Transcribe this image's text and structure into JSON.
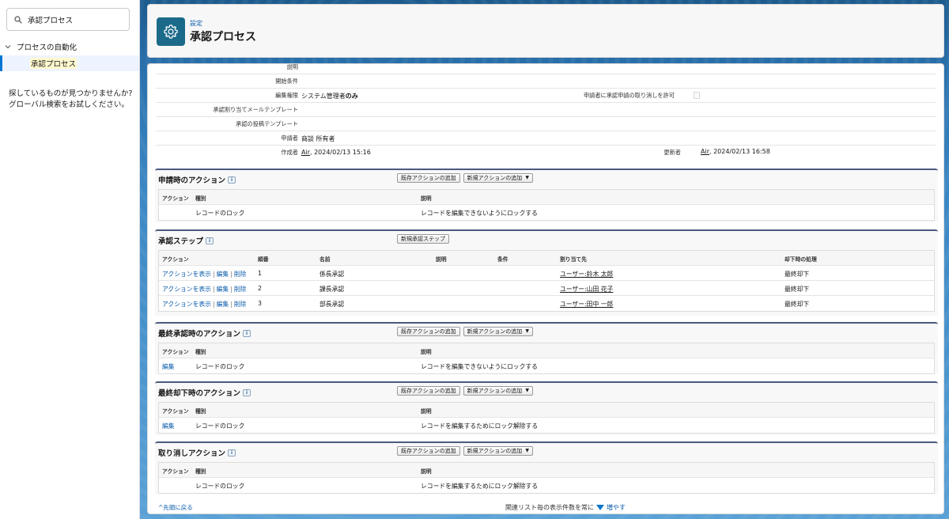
{
  "sidebar": {
    "search_value": "承認プロセス",
    "group_label": "プロセスの自動化",
    "item_label": "承認プロセス",
    "help_line1": "探しているものが見つかりませんか?",
    "help_line2": "グローバル検索をお試しください。"
  },
  "header": {
    "breadcrumb": "設定",
    "title": "承認プロセス"
  },
  "details": {
    "description_label": "説明",
    "entry_criteria_label": "開始条件",
    "edit_permission_label": "編集権限",
    "edit_permission_value_prefix": "システム管理者",
    "edit_permission_value_bold": "のみ",
    "allow_recall_label": "申請者に承認申請の取り消しを許可",
    "assignment_template_label": "承認割り当てメールテンプレート",
    "post_template_label": "承認の投稿テンプレート",
    "submitter_label": "申請者",
    "submitter_value": "商談 所有者",
    "created_by_label": "作成者",
    "created_by_user": "Air",
    "created_by_date": ", 2024/02/13 15:16",
    "modified_by_label": "更新者",
    "modified_by_user": "Air",
    "modified_by_date": ", 2024/02/13 16:58"
  },
  "buttons": {
    "add_existing": "既存アクションの追加",
    "add_new": "新規アクションの追加",
    "new_step": "新規承認ステップ"
  },
  "common_headers": {
    "action": "アクション",
    "type": "種別",
    "description": "説明"
  },
  "initial_submission": {
    "title": "申請時のアクション",
    "rows": [
      {
        "action": "",
        "type": "レコードのロック",
        "description": "レコードを編集できないようにロックする"
      }
    ]
  },
  "approval_steps": {
    "title": "承認ステップ",
    "headers": {
      "action": "アクション",
      "order": "順番",
      "name": "名前",
      "description": "説明",
      "criteria": "条件",
      "assigned_to": "割り当て先",
      "reject_behavior": "却下時の処理"
    },
    "link_view": "アクションを表示",
    "link_edit": "編集",
    "link_delete": "削除",
    "separator": "|",
    "rows": [
      {
        "order": "1",
        "name": "係長承認",
        "assigned_to": "ユーザー:鈴木 太郎",
        "reject_behavior": "最終却下"
      },
      {
        "order": "2",
        "name": "課長承認",
        "assigned_to": "ユーザー:山田 花子",
        "reject_behavior": "最終却下"
      },
      {
        "order": "3",
        "name": "部長承認",
        "assigned_to": "ユーザー:田中 一郎",
        "reject_behavior": "最終却下"
      }
    ]
  },
  "final_approval": {
    "title": "最終承認時のアクション",
    "rows": [
      {
        "action": "編集",
        "type": "レコードのロック",
        "description": "レコードを編集できないようにロックする"
      }
    ]
  },
  "final_rejection": {
    "title": "最終却下時のアクション",
    "rows": [
      {
        "action": "編集",
        "type": "レコードのロック",
        "description": "レコードを編集するためにロック解除する"
      }
    ]
  },
  "recall": {
    "title": "取り消しアクション",
    "rows": [
      {
        "action": "",
        "type": "レコードのロック",
        "description": "レコードを編集するためにロック解除する"
      }
    ]
  },
  "footer": {
    "back_to_top": "先頭に戻る",
    "records_text": "関連リスト毎の表示件数を常に",
    "more_link": "増やす"
  },
  "colors": {
    "brand_blue": "#0b5cab",
    "setup_icon_bg": "#1b6a8a",
    "section_border": "#4a5a7e"
  },
  "icons": {
    "search": "search-icon",
    "chevron": "chevron-down-icon",
    "setup": "gear-icon",
    "info": "info-icon"
  }
}
